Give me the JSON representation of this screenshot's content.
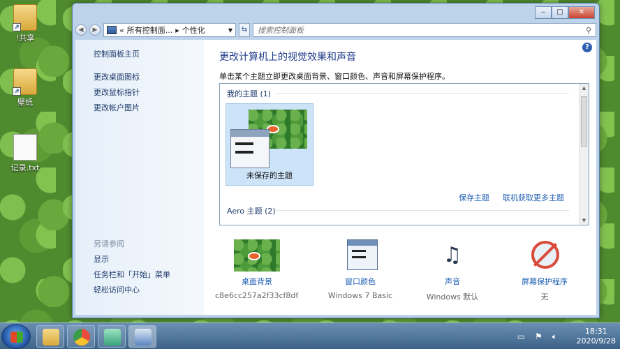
{
  "desktop": {
    "icons": [
      {
        "label": "!共享"
      },
      {
        "label": "壁纸"
      },
      {
        "label": "记录.txt"
      }
    ]
  },
  "window": {
    "caption_buttons": {
      "minimize": "‒",
      "maximize": "□",
      "close": "✕"
    },
    "address": {
      "part1": "所有控制面...",
      "sep": "▸",
      "part2": "个性化",
      "prefix": "«"
    },
    "search_placeholder": "搜索控制面板"
  },
  "sidebar": {
    "items": [
      "控制面板主页",
      "更改桌面图标",
      "更改鼠标指针",
      "更改帐户图片"
    ],
    "see_also_title": "另请参阅",
    "see_also": [
      "显示",
      "任务栏和「开始」菜单",
      "轻松访问中心"
    ]
  },
  "main": {
    "title": "更改计算机上的视觉效果和声音",
    "description": "单击某个主题立即更改桌面背景、窗口颜色、声音和屏幕保护程序。",
    "my_themes_label": "我的主题 (1)",
    "unsaved_theme": "未保存的主题",
    "save_theme": "保存主题",
    "get_more": "联机获取更多主题",
    "aero_label": "Aero 主题 (2)"
  },
  "bottom": [
    {
      "label": "桌面背景",
      "value": "c8e6cc257a2f33cf8dfd..."
    },
    {
      "label": "窗口颜色",
      "value": "Windows 7 Basic"
    },
    {
      "label": "声音",
      "value": "Windows 默认"
    },
    {
      "label": "屏幕保护程序",
      "value": "无"
    }
  ],
  "taskbar": {
    "time": "18:31",
    "date": "2020/9/28"
  },
  "colors": {
    "accent": "#1e5fb4",
    "title": "#1e3a8a"
  }
}
